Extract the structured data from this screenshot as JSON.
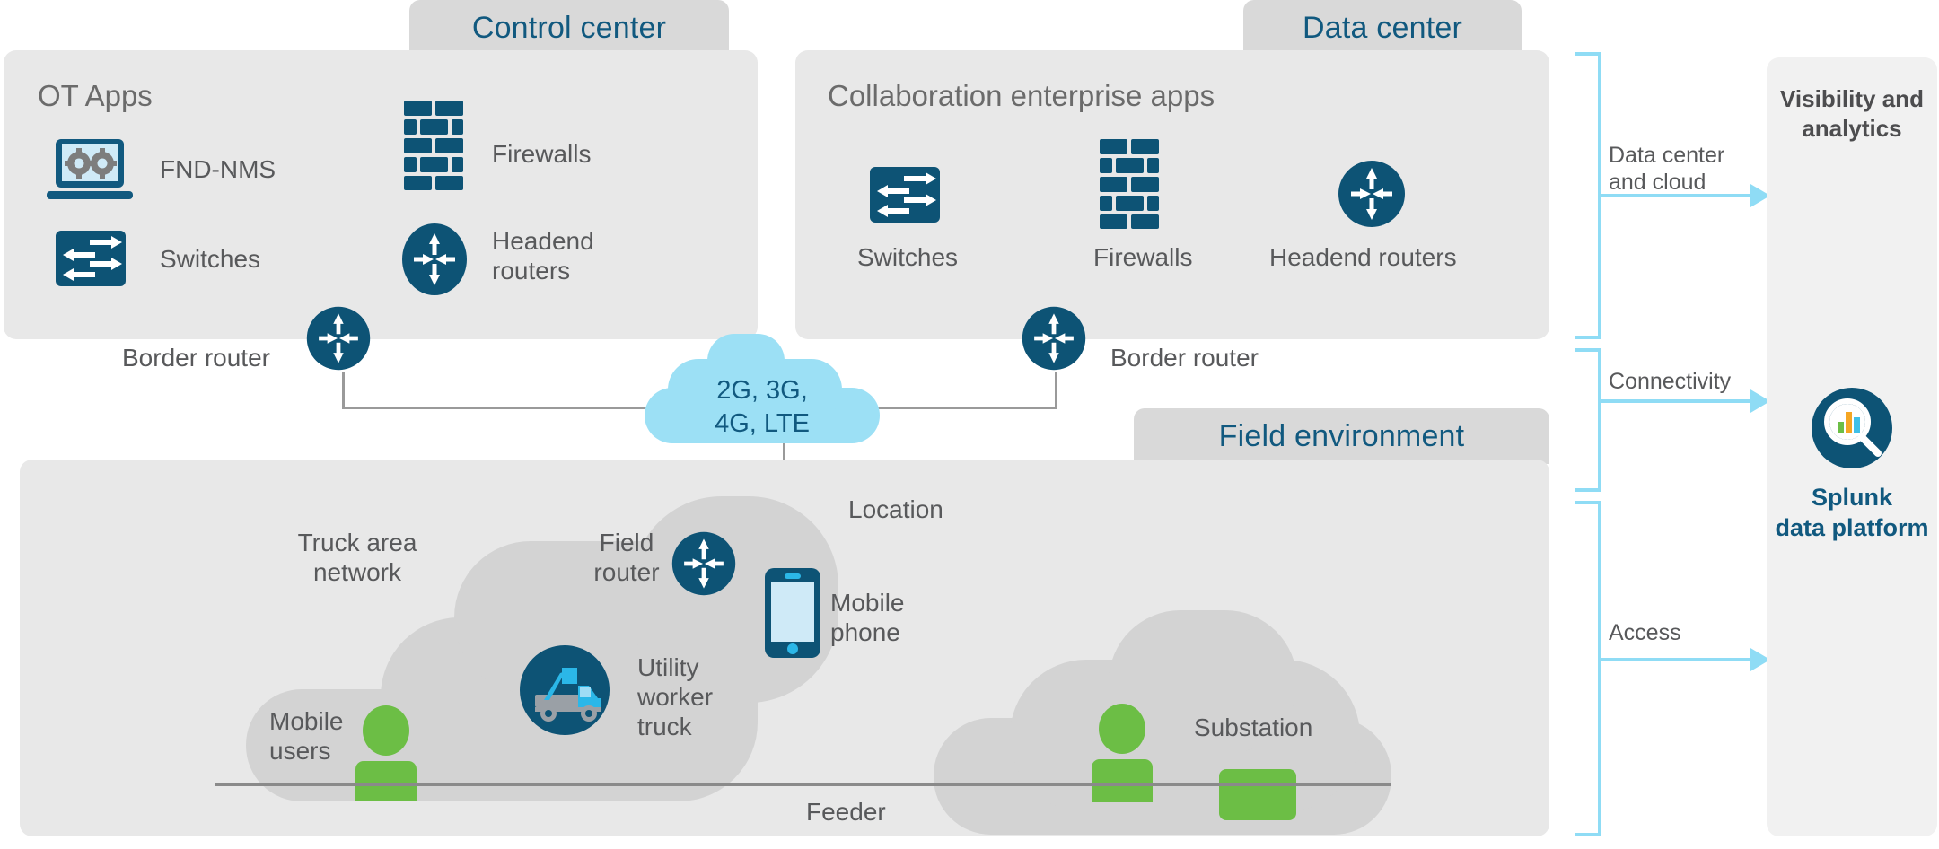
{
  "zones": {
    "control_center": {
      "tab_label": "Control center",
      "group_title": "OT Apps",
      "items": [
        {
          "label": "FND-NMS",
          "icon": "laptop-gears-icon"
        },
        {
          "label": "Firewalls",
          "icon": "firewall-brick-icon"
        },
        {
          "label": "Switches",
          "icon": "switch-icon"
        },
        {
          "label": "Headend\nrouters",
          "icon": "router-icon"
        }
      ],
      "border_router_label": "Border router"
    },
    "data_center": {
      "tab_label": "Data center",
      "group_title": "Collaboration enterprise apps",
      "items": [
        {
          "label": "Switches",
          "icon": "switch-icon"
        },
        {
          "label": "Firewalls",
          "icon": "firewall-brick-icon"
        },
        {
          "label": "Headend routers",
          "icon": "router-icon"
        }
      ],
      "border_router_label": "Border router"
    },
    "field_environment": {
      "tab_label": "Field environment",
      "location_label": "Location",
      "truck_area_network_label": "Truck area\nnetwork",
      "field_router_label": "Field\nrouter",
      "mobile_phone_label": "Mobile\nphone",
      "utility_worker_truck_label": "Utility\nworker\ntruck",
      "mobile_users_label": "Mobile\nusers",
      "substation_label": "Substation",
      "feeder_label": "Feeder"
    }
  },
  "telco_cloud": {
    "line1": "2G, 3G,",
    "line2": "4G, LTE"
  },
  "rail": {
    "segments": [
      {
        "label_line1": "Data center",
        "label_line2": "and cloud"
      },
      {
        "label_line1": "Connectivity",
        "label_line2": ""
      },
      {
        "label_line1": "Access",
        "label_line2": ""
      }
    ]
  },
  "analytics": {
    "title_line1": "Visibility and",
    "title_line2": "analytics",
    "product_line1": "Splunk",
    "product_line2": "data platform",
    "icon": "splunk-magnifier-bars-icon"
  },
  "colors": {
    "cisco_blue": "#11597f",
    "panel_gray": "#e8e8e8",
    "tab_gray": "#d9d9d9",
    "cloud_blue": "#9ce0f5",
    "arrow_blue": "#8fdcf5",
    "green": "#6cbe45",
    "text_gray": "#58595b",
    "analytics_panel": "#f1f1f1"
  }
}
